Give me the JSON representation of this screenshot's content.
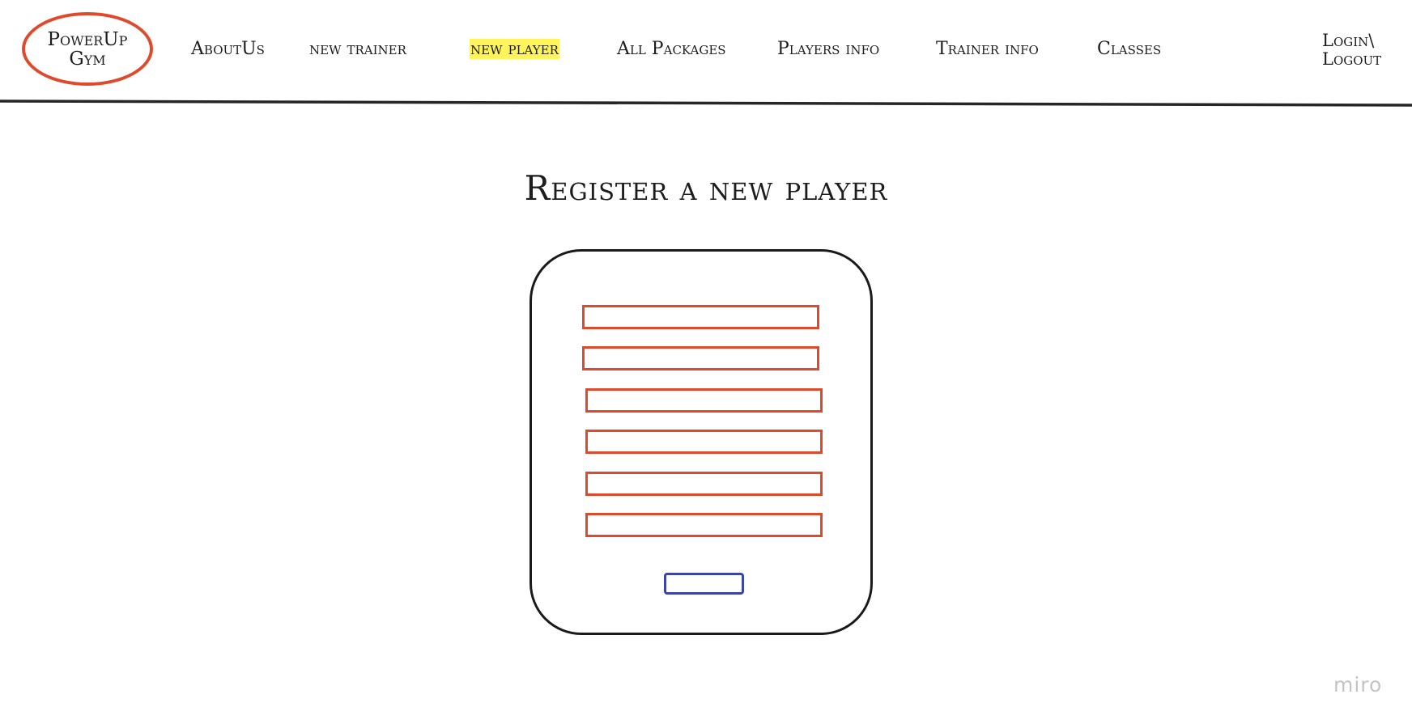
{
  "logo": {
    "line1": "PowerUp",
    "line2": "Gym"
  },
  "nav": {
    "items": [
      {
        "label": "AboutUs",
        "active": false
      },
      {
        "label": "new trainer",
        "active": false
      },
      {
        "label": "new player",
        "active": true
      },
      {
        "label": "All Packages",
        "active": false
      },
      {
        "label": "Players info",
        "active": false
      },
      {
        "label": "Trainer info",
        "active": false
      },
      {
        "label": "Classes",
        "active": false
      }
    ],
    "login_line1": "Login\\",
    "login_line2": "Logout"
  },
  "main": {
    "title": "Register a new player",
    "form": {
      "fields": [
        {
          "value": ""
        },
        {
          "value": ""
        },
        {
          "value": ""
        },
        {
          "value": ""
        },
        {
          "value": ""
        },
        {
          "value": ""
        }
      ],
      "submit_label": ""
    }
  },
  "watermark": "miro",
  "colors": {
    "accent": "#e04a2c",
    "highlight": "#fff45a",
    "button_border": "#3b45a8",
    "text": "#1d1d1d",
    "watermark": "#c4c4c4"
  }
}
